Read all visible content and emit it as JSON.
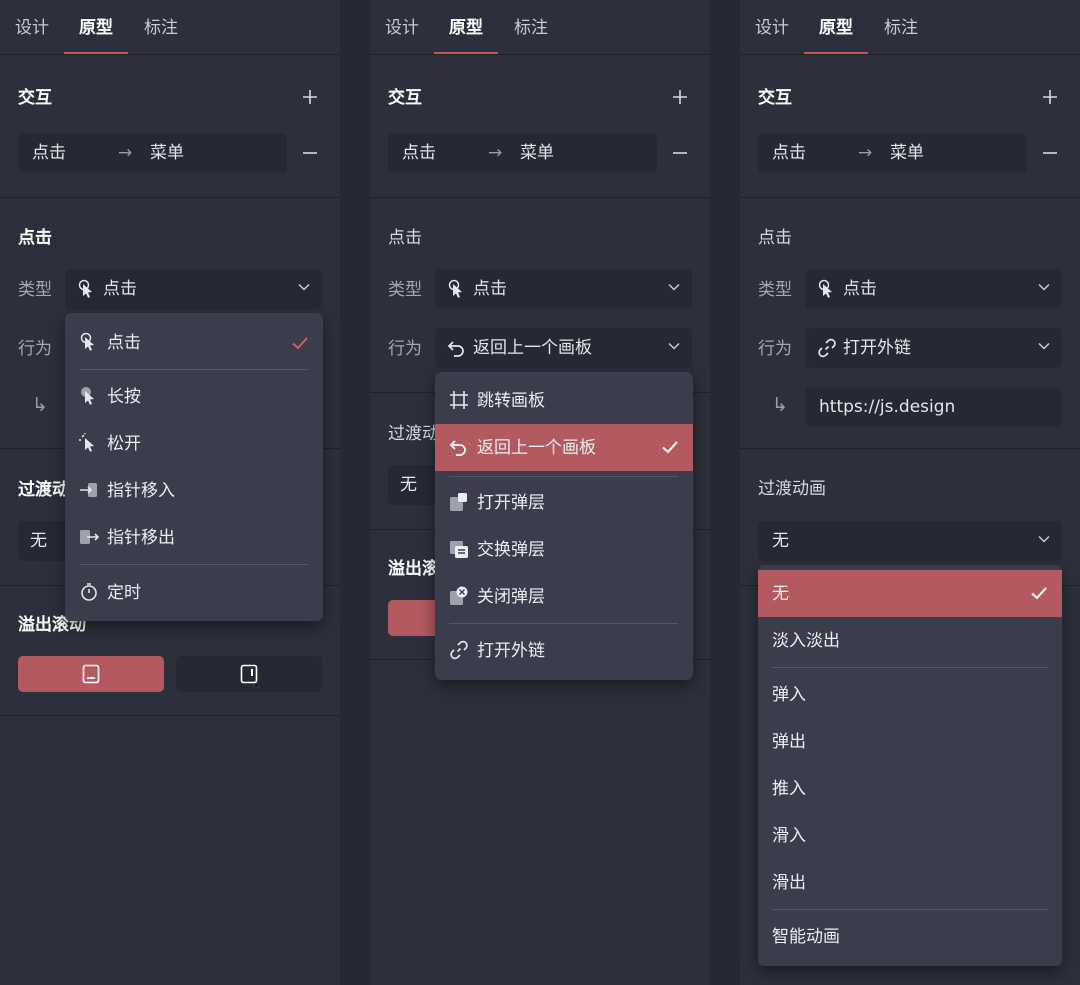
{
  "tabs": [
    "设计",
    "原型",
    "标注"
  ],
  "interaction": {
    "title": "交互",
    "trigger": "点击",
    "arrow": "→",
    "target": "菜单",
    "return_arrow": "↳"
  },
  "colors": {
    "panel_bg": "#2d303c",
    "field_bg": "#262934",
    "menu_bg": "#3a3d4b",
    "accent": "#b35a60",
    "check_accent": "#e2575c"
  },
  "panel1": {
    "click_title": "点击",
    "type_label": "类型",
    "type_value": "点击",
    "action_label": "行为",
    "transition_title": "过渡动",
    "transition_value": "无",
    "overflow_title": "溢出滚动",
    "type_menu": [
      {
        "label": "点击",
        "icon": "pointer-click-icon",
        "selected": true
      },
      {
        "label": "长按",
        "icon": "pointer-long-press-icon"
      },
      {
        "label": "松开",
        "icon": "pointer-release-icon"
      },
      {
        "label": "指针移入",
        "icon": "pointer-enter-icon"
      },
      {
        "label": "指针移出",
        "icon": "pointer-leave-icon"
      },
      {
        "label": "定时",
        "icon": "timer-icon"
      }
    ]
  },
  "panel2": {
    "click_title": "点击",
    "type_label": "类型",
    "type_value": "点击",
    "action_label": "行为",
    "action_value": "返回上一个画板",
    "transition_title": "过渡动",
    "transition_value": "无",
    "overflow_title": "溢出滚",
    "action_menu": [
      {
        "label": "跳转画板",
        "icon": "frame-icon"
      },
      {
        "label": "返回上一个画板",
        "icon": "back-arrow-icon",
        "selected": true
      },
      {
        "label": "打开弹层",
        "icon": "open-overlay-icon"
      },
      {
        "label": "交换弹层",
        "icon": "swap-overlay-icon"
      },
      {
        "label": "关闭弹层",
        "icon": "close-overlay-icon"
      },
      {
        "label": "打开外链",
        "icon": "link-icon"
      }
    ]
  },
  "panel3": {
    "click_title": "点击",
    "type_label": "类型",
    "type_value": "点击",
    "action_label": "行为",
    "action_value": "打开外链",
    "url_value": "https://js.design",
    "transition_title": "过渡动画",
    "transition_value": "无",
    "transition_menu": [
      {
        "label": "无",
        "selected": true
      },
      {
        "label": "淡入淡出"
      },
      {
        "label": "弹入"
      },
      {
        "label": "弹出"
      },
      {
        "label": "推入"
      },
      {
        "label": "滑入"
      },
      {
        "label": "滑出"
      },
      {
        "label": "智能动画"
      }
    ]
  }
}
